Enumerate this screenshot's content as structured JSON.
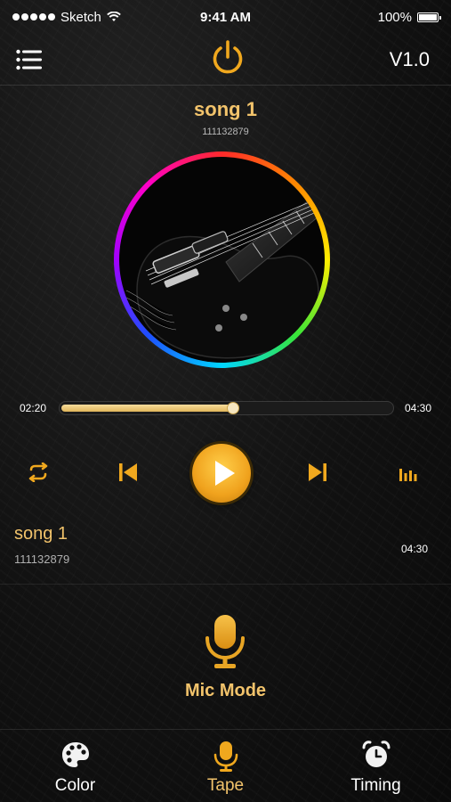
{
  "status_bar": {
    "carrier": "Sketch",
    "time": "9:41 AM",
    "battery": "100%"
  },
  "header": {
    "version": "V1.0",
    "menu_icon": "hamburger-menu-icon",
    "power_icon": "power-icon"
  },
  "now_playing": {
    "title": "song 1",
    "subtitle": "111132879",
    "artwork": "guitar-artwork"
  },
  "progress": {
    "elapsed": "02:20",
    "total": "04:30",
    "fraction": 0.52
  },
  "controls": {
    "repeat_icon": "repeat-icon",
    "prev_icon": "skip-previous-icon",
    "play_icon": "play-icon",
    "next_icon": "skip-next-icon",
    "eq_icon": "equalizer-icon"
  },
  "playlist": [
    {
      "title": "song 1",
      "subtitle": "111132879",
      "duration": "04:30"
    }
  ],
  "mode": {
    "label": "Mic Mode",
    "icon": "microphone-icon"
  },
  "tabs": [
    {
      "label": "Color",
      "icon": "palette-icon",
      "active": false
    },
    {
      "label": "Tape",
      "icon": "microphone-icon",
      "active": true
    },
    {
      "label": "Timing",
      "icon": "alarm-clock-icon",
      "active": false
    }
  ],
  "colors": {
    "accent": "#f2c36b",
    "play_button": "#f0a21d",
    "background": "#111111"
  }
}
